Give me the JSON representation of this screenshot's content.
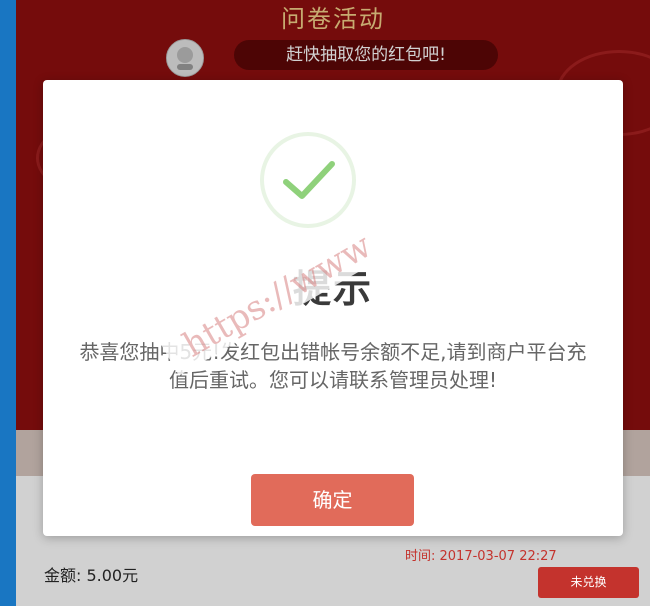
{
  "header": {
    "title": "问卷活动",
    "prompt": "赶快抽取您的红包吧!"
  },
  "record": {
    "amount_label": "金额: 5.00元",
    "time_label": "时间: 2017-03-07 22:27",
    "status_label": "未兑换"
  },
  "dialog": {
    "title": "提示",
    "message": "恭喜您抽中5元!发红包出错帐号余额不足,请到商户平台充值后重试。您可以请联系管理员处理!",
    "confirm_label": "确定"
  },
  "watermark": {
    "text": "https://www"
  },
  "icons": {
    "check": "check-icon",
    "avatar": "avatar-image"
  },
  "colors": {
    "background_red": "#8f0f0f",
    "accent_blue": "#1976c2",
    "button": "#e16b5a",
    "check_green": "#8fd17b"
  }
}
